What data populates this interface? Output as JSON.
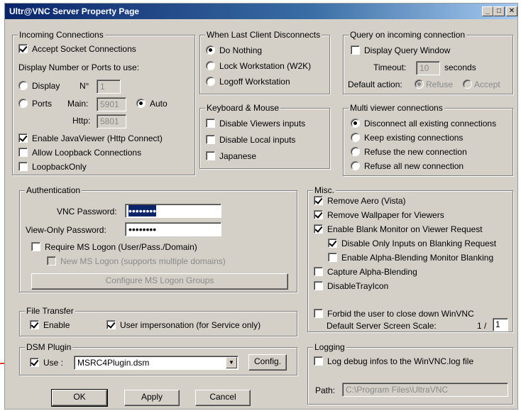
{
  "window": {
    "title": "Ultr@VNC Server Property Page"
  },
  "incoming": {
    "title": "Incoming Connections",
    "accept_socket": "Accept Socket Connections",
    "display_ports_label": "Display Number or Ports to use:",
    "display_label": "Display",
    "no_label": "N°",
    "display_value": "1",
    "ports_label": "Ports",
    "main_label": "Main:",
    "main_value": "5901",
    "auto_label": "Auto",
    "http_label": "Http:",
    "http_value": "5801",
    "enable_javaviewer": "Enable JavaViewer (Http Connect)",
    "allow_loopback": "Allow Loopback Connections",
    "loopback_only": "LoopbackOnly"
  },
  "last_client": {
    "title": "When Last Client Disconnects",
    "do_nothing": "Do Nothing",
    "lock_workstation": "Lock Workstation (W2K)",
    "logoff_workstation": "Logoff Workstation"
  },
  "query": {
    "title": "Query on incoming connection",
    "display_query_window": "Display Query Window",
    "timeout_label": "Timeout:",
    "timeout_value": "10",
    "seconds_label": "seconds",
    "default_action_label": "Default action:",
    "refuse_label": "Refuse",
    "accept_label": "Accept"
  },
  "keyboard": {
    "title": "Keyboard & Mouse",
    "disable_viewers_inputs": "Disable Viewers inputs",
    "disable_local_inputs": "Disable Local inputs",
    "japanese": "Japanese"
  },
  "multiviewer": {
    "title": "Multi viewer connections",
    "disconnect_all": "Disconnect all existing connections",
    "keep_existing": "Keep existing connections",
    "refuse_new": "Refuse the new connection",
    "refuse_all_new": "Refuse all new connection"
  },
  "auth": {
    "title": "Authentication",
    "vnc_password_label": "VNC Password:",
    "vnc_password_value": "••••••••",
    "viewonly_password_label": "View-Only Password:",
    "viewonly_password_value": "••••••••",
    "require_ms_logon": "Require MS Logon  (User/Pass./Domain)",
    "new_ms_logon": "New MS Logon (supports multiple domains)",
    "configure_ms_logon_groups": "Configure MS Logon Groups"
  },
  "misc": {
    "title": "Misc.",
    "remove_aero": "Remove Aero (Vista)",
    "remove_wallpaper": "Remove Wallpaper for Viewers",
    "enable_blank_monitor": "Enable Blank Monitor on Viewer Request",
    "disable_only_inputs": "Disable Only Inputs on Blanking Request",
    "enable_alpha_blending_blanking": "Enable Alpha-Blending Monitor Blanking",
    "capture_alpha_blending": "Capture Alpha-Blending",
    "disable_tray_icon": "DisableTrayIcon",
    "forbid_close_down": "Forbid the user to close down WinVNC",
    "default_scale_label": "Default Server Screen Scale:",
    "scale_prefix": "1 /",
    "scale_value": "1"
  },
  "file_transfer": {
    "title": "File Transfer",
    "enable": "Enable",
    "user_impersonation": "User impersonation (for Service only)"
  },
  "dsm": {
    "title": "DSM Plugin",
    "use_label": "Use :",
    "plugin_value": "MSRC4Plugin.dsm",
    "config_button": "Config."
  },
  "logging": {
    "title": "Logging",
    "log_debug": "Log debug infos to the WinVNC.log file",
    "path_label": "Path:",
    "path_value": "C:\\Program Files\\UltraVNC"
  },
  "buttons": {
    "ok": "OK",
    "apply": "Apply",
    "cancel": "Cancel"
  },
  "titlebar_buttons": {
    "minimize_icon": "minimize-icon",
    "maximize_icon": "maximize-icon",
    "close_icon": "close-icon"
  }
}
